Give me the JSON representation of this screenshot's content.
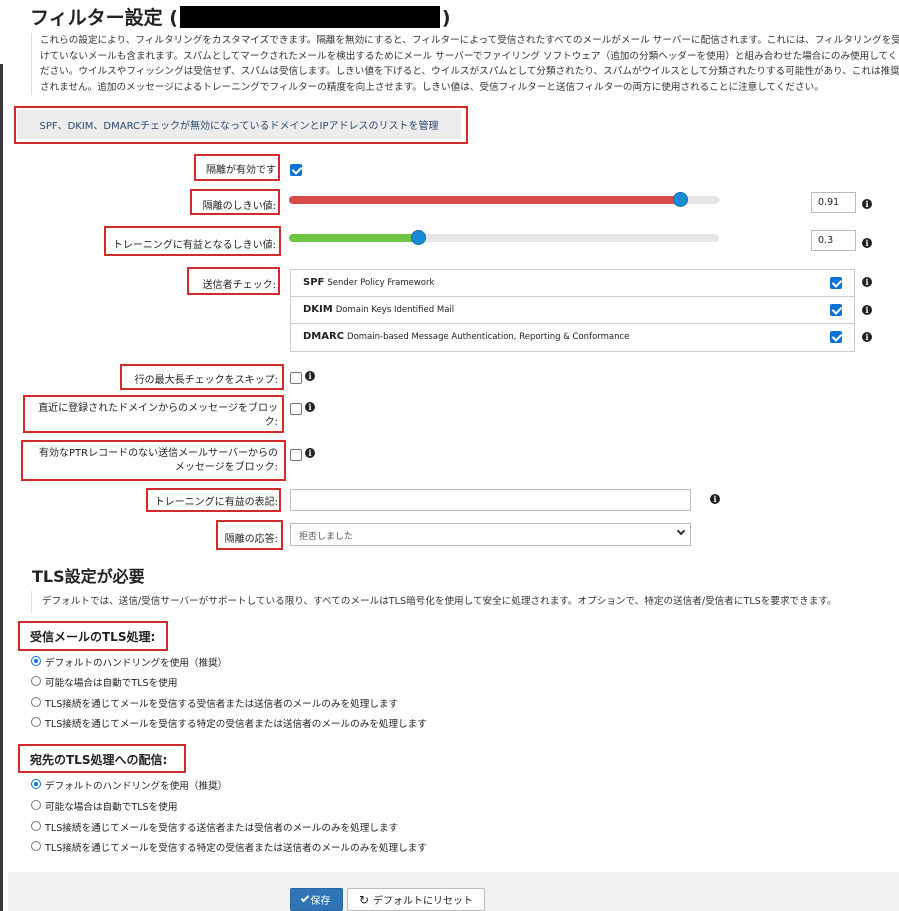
{
  "page": {
    "title_prefix": "フィルター設定 (",
    "title_suffix": ")",
    "intro": "これらの設定により、フィルタリングをカスタマイズできます。隔離を無効にすると、フィルターによって受信されたすべてのメールがメール サーバーに配信されます。これには、フィルタリングを受けていないメールも含まれます。スパムとしてマークされたメールを検出するためにメール サーバーでファイリング ソフトウェア（追加の分類ヘッダーを使用）と組み合わせた場合にのみ使用してください。ウイルスやフィッシングは受信せず、スパムは受信します。しきい値を下げると、ウイルスがスパムとして分類されたり、スパムがウイルスとして分類されたりする可能性があり、これは推奨されません。追加のメッセージによるトレーニングでフィルターの精度を向上させます。しきい値は、受信フィルターと送信フィルターの両方に使用されることに注意してください。"
  },
  "spf_link": "SPF、DKIM、DMARCチェックが無効になっているドメインとIPアドレスのリストを管理",
  "quarantine": {
    "label": "隔離が有効です",
    "checked": true
  },
  "quarantine_threshold": {
    "label": "隔離のしきい値:",
    "value": "0.91",
    "level": 0.91
  },
  "training_threshold": {
    "label": "トレーニングに有益となるしきい値:",
    "value": "0.3",
    "level": 0.3
  },
  "sender_checks": {
    "label": "送信者チェック:",
    "items": [
      {
        "abbr": "SPF",
        "name": "Sender Policy Framework",
        "checked": true
      },
      {
        "abbr": "DKIM",
        "name": "Domain Keys Identified Mail",
        "checked": true
      },
      {
        "abbr": "DMARC",
        "name": "Domain-based Message Authentication, Reporting & Conformance",
        "checked": true
      }
    ]
  },
  "skip_line_length": {
    "label": "行の最大長チェックをスキップ:",
    "checked": false
  },
  "block_new_domains": {
    "label_line1": "直近に登録されたドメインからのメッセージをブロッ",
    "label_line2": "ク:",
    "checked": false
  },
  "block_no_ptr": {
    "label_line1": "有効なPTRレコードのない送信メールサーバーからの",
    "label_line2": "メッセージをブロック:",
    "checked": false
  },
  "training_notation": {
    "label": "トレーニングに有益の表記:",
    "value": ""
  },
  "quarantine_response": {
    "label": "隔離の応答:",
    "selected": "拒否しました"
  },
  "tls": {
    "heading": "TLS設定が必要",
    "description": "デフォルトでは、送信/受信サーバーがサポートしている限り、すべてのメールはTLS暗号化を使用して安全に処理されます。オプションで、特定の送信者/受信者にTLSを要求できます。",
    "inbound": {
      "heading": "受信メールのTLS処理:",
      "options": [
        "デフォルトのハンドリングを使用（推奨）",
        "可能な場合は自動でTLSを使用",
        "TLS接続を通じてメールを受信する受信者または送信者のメールのみを処理します",
        "TLS接続を通じてメールを受信する特定の受信者または送信者のメールのみを処理します"
      ],
      "selected_index": 0
    },
    "outbound": {
      "heading": "宛先のTLS処理への配信:",
      "options": [
        "デフォルトのハンドリングを使用（推奨）",
        "可能な場合は自動でTLSを使用",
        "TLS接続を通じてメールを受信する送信者または受信者のメールのみを処理します",
        "TLS接続を通じてメールを受信する特定の受信者または送信者のメールのみを処理します"
      ],
      "selected_index": 0
    }
  },
  "buttons": {
    "save": "保存",
    "reset": "デフォルトにリセット"
  },
  "icons": {
    "info": "info-icon",
    "save": "check-icon",
    "reset": "refresh-icon",
    "select": "chevron-down-icon"
  },
  "colors": {
    "accent": "#0b73d6",
    "highlight_border": "#d32b2b",
    "quarantine_slider": "#d94b4b",
    "training_slider": "#6cc644",
    "save_button": "#2f75b5"
  }
}
